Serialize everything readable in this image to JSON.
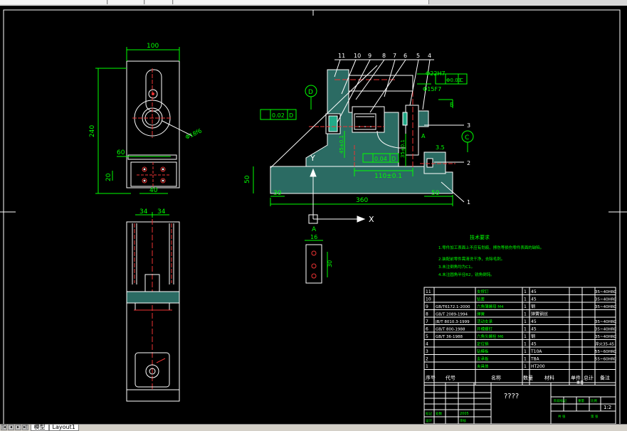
{
  "tabs": {
    "model": "模型",
    "layout": "Layout1"
  },
  "dims": {
    "top_width": "100",
    "height_240": "240",
    "dia_18": "Φ18f6",
    "w60": "60",
    "w20": "20",
    "w40": "40",
    "w34a": "34",
    "w34b": "34",
    "w16": "16",
    "w30": "30",
    "w360": "360",
    "w50": "50",
    "w30b": "30",
    "w50b": "50",
    "w110": "110±0.1",
    "w35": "3.5",
    "phi22": "Φ22H7",
    "phi15": "Φ15F7",
    "tol_c": "Φ0.03",
    "tol_d": "0.02",
    "tol_b": "0.04",
    "dim_v": "35±0.1",
    "dim_v2": "45±0.1"
  },
  "datums": {
    "d": "D",
    "c": "C",
    "b": "B",
    "a": "A",
    "x": "X",
    "y": "Y",
    "sec_a": "A",
    "c2": "C",
    "d2": "D"
  },
  "balloons": [
    "11",
    "10",
    "9",
    "8",
    "7",
    "6",
    "5",
    "4",
    "3",
    "2",
    "1"
  ],
  "tech": {
    "title": "技术要求",
    "lines": [
      "1.零件加工表面上不应有划痕、擦伤等损伤零件表面的缺陷。",
      "2.装配前零件需清洗干净，去除毛刺。",
      "3.未注倒角均为C1。",
      "4.未注圆角半径R2，锐角倒钝。"
    ]
  },
  "bom": [
    {
      "no": "11",
      "code": "",
      "name": "支撑钉",
      "qty": "1",
      "mat": "45",
      "note": "35~40HRC"
    },
    {
      "no": "10",
      "code": "",
      "name": "钻套",
      "qty": "1",
      "mat": "45",
      "note": "35~40HRC"
    },
    {
      "no": "9",
      "code": "GB/T6172.1-2000",
      "name": "六角薄螺母 M4",
      "qty": "1",
      "mat": "钢",
      "note": "35~40HRC"
    },
    {
      "no": "8",
      "code": "GB/T 2089-1994",
      "name": "弹簧",
      "qty": "1",
      "mat": "弹簧钢丝",
      "note": ""
    },
    {
      "no": "7",
      "code": "JB/T 8010.3-1999",
      "name": "活动支承",
      "qty": "1",
      "mat": "45",
      "note": "35~40HRC"
    },
    {
      "no": "6",
      "code": "GB/T 800-1988",
      "name": "开槽螺钉",
      "qty": "1",
      "mat": "45",
      "note": "35~40HRC"
    },
    {
      "no": "5",
      "code": "GB/T 36-1988",
      "name": "六角头螺栓 M6",
      "qty": "1",
      "mat": "钢",
      "note": "35~40HRC"
    },
    {
      "no": "4",
      "code": "",
      "name": "定位销",
      "qty": "1",
      "mat": "45",
      "note": "淬火35-45"
    },
    {
      "no": "3",
      "code": "",
      "name": "钻模板",
      "qty": "1",
      "mat": "T10A",
      "note": "55~60HRC"
    },
    {
      "no": "2",
      "code": "",
      "name": "支承板",
      "qty": "1",
      "mat": "T8A",
      "note": "55~60HRC"
    },
    {
      "no": "1",
      "code": "",
      "name": "夹具体",
      "qty": "1",
      "mat": "HT200",
      "note": ""
    }
  ],
  "bom_header": {
    "no": "序号",
    "code": "代号",
    "name": "名称",
    "qty": "数量",
    "mat": "材料",
    "w1": "单件",
    "w2": "总计",
    "wt": "重量",
    "note": "备注"
  },
  "title_block": {
    "name": "????",
    "scale": "1:2",
    "date": "2005",
    "a": "标记",
    "b": "处数",
    "c": "分区",
    "d": "签名",
    "e": "年月日",
    "f": "阶段标记",
    "g": "重量",
    "h": "比例",
    "i": "设计",
    "j": "审核",
    "k": "工艺",
    "l": "批准",
    "m": "共 张",
    "n": "第 张"
  }
}
